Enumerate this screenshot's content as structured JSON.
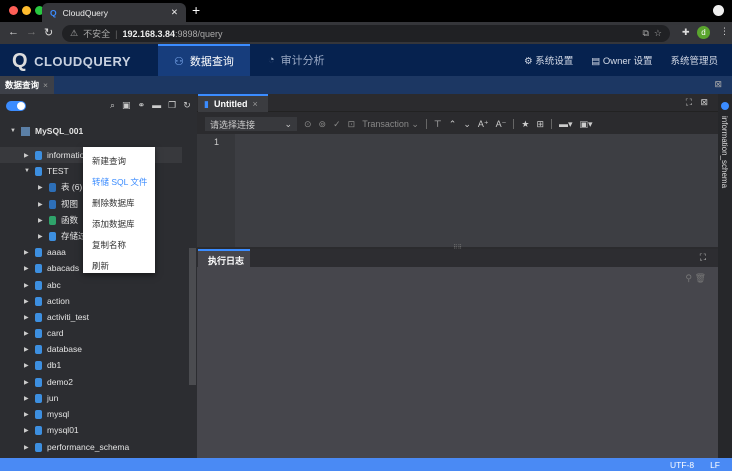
{
  "browser": {
    "tab_title": "CloudQuery",
    "insecure_label": "不安全",
    "url_host": "192.168.3.84",
    "url_rest": ":9898/query",
    "avatar_letter": "d"
  },
  "header": {
    "logo": "CLOUDQUERY",
    "nav": [
      {
        "label": "数据查询",
        "active": true
      },
      {
        "label": "审计分析",
        "active": false
      }
    ],
    "right": [
      "系统设置",
      "Owner 设置",
      "系统管理员"
    ]
  },
  "page_tab": "数据查询",
  "tree": {
    "root": "MySQL_001",
    "items": [
      {
        "label": "information_schema",
        "level": 1,
        "expanded": false
      },
      {
        "label": "TEST",
        "level": 1,
        "expanded": true
      },
      {
        "label": "表 (6)",
        "level": 2
      },
      {
        "label": "视图",
        "level": 2
      },
      {
        "label": "函数",
        "level": 2
      },
      {
        "label": "存储过程",
        "level": 2
      },
      {
        "label": "aaaa",
        "level": 1
      },
      {
        "label": "abacads",
        "level": 1
      },
      {
        "label": "abc",
        "level": 1
      },
      {
        "label": "action",
        "level": 1
      },
      {
        "label": "activiti_test",
        "level": 1
      },
      {
        "label": "card",
        "level": 1
      },
      {
        "label": "database",
        "level": 1
      },
      {
        "label": "db1",
        "level": 1
      },
      {
        "label": "demo2",
        "level": 1
      },
      {
        "label": "jun",
        "level": 1
      },
      {
        "label": "mysql",
        "level": 1
      },
      {
        "label": "mysql01",
        "level": 1
      },
      {
        "label": "performance_schema",
        "level": 1
      }
    ]
  },
  "context_menu": [
    {
      "label": "新建查询"
    },
    {
      "label": "转储 SQL 文件",
      "highlight": true
    },
    {
      "label": "删除数据库"
    },
    {
      "label": "添加数据库"
    },
    {
      "label": "复制名称"
    },
    {
      "label": "刷新"
    }
  ],
  "editor": {
    "tab": "Untitled",
    "connection_placeholder": "请选择连接",
    "transaction": "Transaction",
    "line_numbers": [
      "1"
    ]
  },
  "log": {
    "tab": "执行日志"
  },
  "right_panel": {
    "label": "information_schema"
  },
  "status": {
    "encoding": "UTF-8",
    "eol": "LF"
  },
  "colors": {
    "accent": "#3b8cff",
    "status_bar": "#4a8af4",
    "header": "#06224f"
  }
}
